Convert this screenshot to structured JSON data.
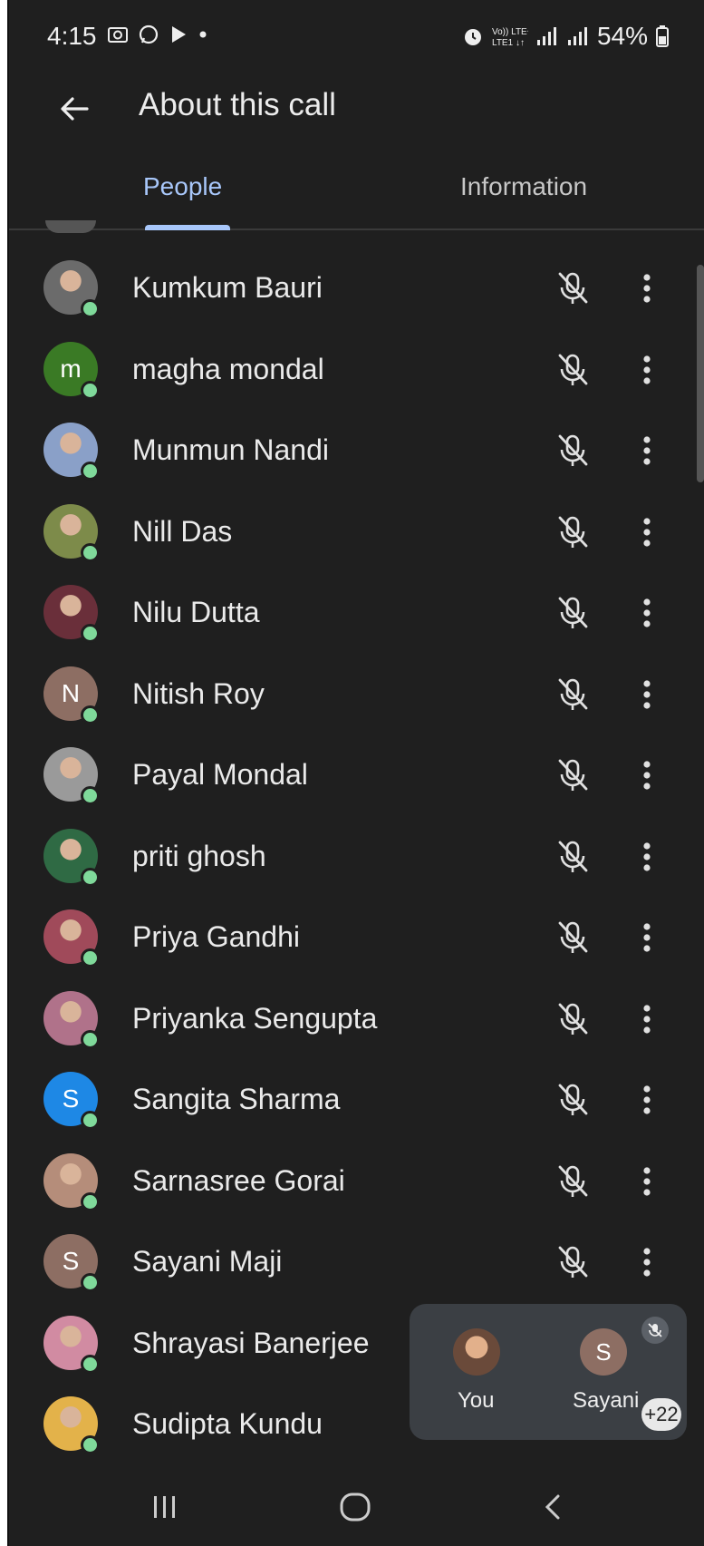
{
  "status_bar": {
    "time": "4:15",
    "battery": "54%"
  },
  "app_bar": {
    "title": "About this call"
  },
  "tabs": [
    {
      "label": "People",
      "selected": true
    },
    {
      "label": "Information",
      "selected": false
    }
  ],
  "participants": [
    {
      "name": "Kumkum Bauri",
      "avatar": "photo",
      "avatar_color": "#6b6b6b",
      "initial": ""
    },
    {
      "name": "magha mondal",
      "avatar": "initial",
      "avatar_color": "#3a7a25",
      "initial": "m"
    },
    {
      "name": "Munmun Nandi",
      "avatar": "photo",
      "avatar_color": "#8aa0c8",
      "initial": ""
    },
    {
      "name": "Nill Das",
      "avatar": "photo",
      "avatar_color": "#7d8b4a",
      "initial": ""
    },
    {
      "name": "Nilu Dutta",
      "avatar": "photo",
      "avatar_color": "#6a2f3a",
      "initial": ""
    },
    {
      "name": "Nitish Roy",
      "avatar": "initial",
      "avatar_color": "#8d6e63",
      "initial": "N"
    },
    {
      "name": "Payal Mondal",
      "avatar": "photo",
      "avatar_color": "#9a9a9a",
      "initial": ""
    },
    {
      "name": "priti ghosh",
      "avatar": "photo",
      "avatar_color": "#2f6a44",
      "initial": ""
    },
    {
      "name": "Priya Gandhi",
      "avatar": "photo",
      "avatar_color": "#a04a5a",
      "initial": ""
    },
    {
      "name": "Priyanka Sengupta",
      "avatar": "photo",
      "avatar_color": "#b0728a",
      "initial": ""
    },
    {
      "name": "Sangita Sharma",
      "avatar": "initial",
      "avatar_color": "#1e88e5",
      "initial": "S"
    },
    {
      "name": "Sarnasree Gorai",
      "avatar": "photo",
      "avatar_color": "#b58d7a",
      "initial": ""
    },
    {
      "name": "Sayani Maji",
      "avatar": "initial",
      "avatar_color": "#8d6e63",
      "initial": "S"
    },
    {
      "name": "Shrayasi Banerjee",
      "avatar": "photo",
      "avatar_color": "#d18ba2",
      "initial": ""
    },
    {
      "name": "Sudipta Kundu",
      "avatar": "photo",
      "avatar_color": "#e3b24a",
      "initial": ""
    }
  ],
  "mini_call": {
    "you_label": "You",
    "other_initial": "S",
    "other_label": "Sayani",
    "extra_count": "+22"
  },
  "colors": {
    "background": "#1f1f1f",
    "accent": "#a8c7fa",
    "online_dot": "#7fd99a"
  }
}
